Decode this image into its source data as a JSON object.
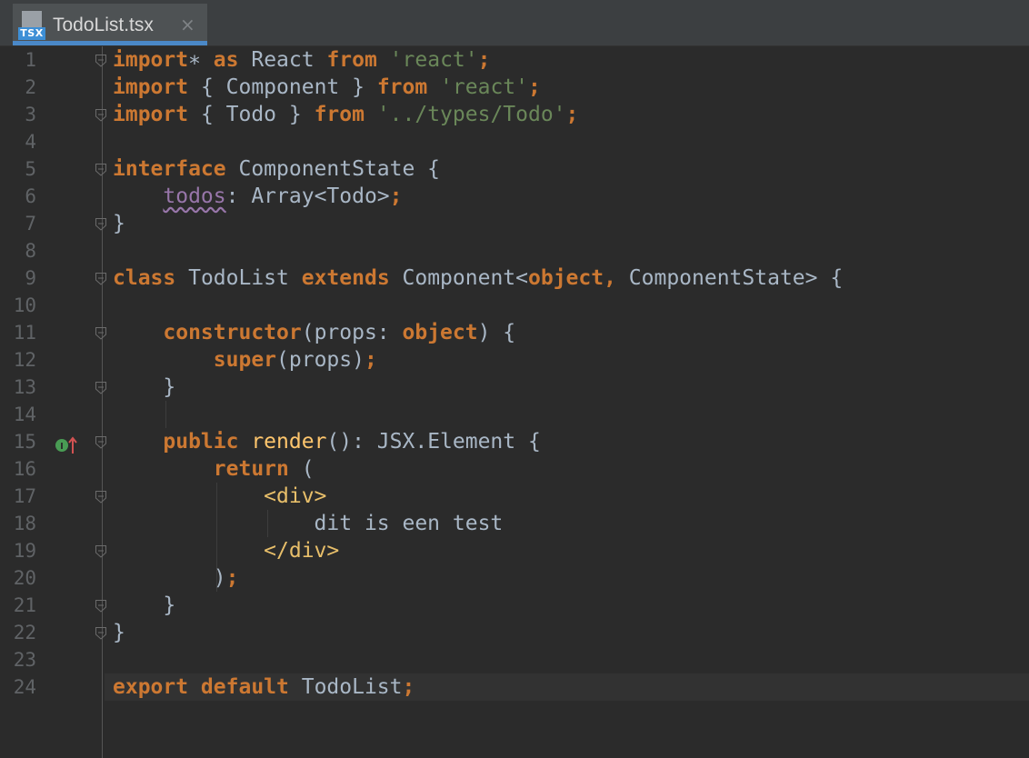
{
  "tab": {
    "file_type_badge": "TSX",
    "title": "TodoList.tsx",
    "close_glyph": "×"
  },
  "editor": {
    "line_numbers": [
      "1",
      "2",
      "3",
      "4",
      "5",
      "6",
      "7",
      "8",
      "9",
      "10",
      "11",
      "12",
      "13",
      "14",
      "15",
      "16",
      "17",
      "18",
      "19",
      "20",
      "21",
      "22",
      "23",
      "24"
    ],
    "gutter_icons": {
      "line15": "implements-method-icon"
    },
    "lines": [
      [
        [
          "kw",
          "import"
        ],
        [
          "",
          "∗"
        ],
        [
          "kw",
          " as"
        ],
        [
          "",
          " React "
        ],
        [
          "kw",
          "from"
        ],
        [
          "str",
          " 'react'"
        ],
        [
          "kw",
          ";"
        ]
      ],
      [
        [
          "kw",
          "import"
        ],
        [
          "",
          " { Component } "
        ],
        [
          "kw",
          "from"
        ],
        [
          "str",
          " 'react'"
        ],
        [
          "kw",
          ";"
        ]
      ],
      [
        [
          "kw",
          "import"
        ],
        [
          "",
          " { Todo } "
        ],
        [
          "kw",
          "from"
        ],
        [
          "str",
          " '../types/Todo'"
        ],
        [
          "kw",
          ";"
        ]
      ],
      [],
      [
        [
          "kw",
          "interface"
        ],
        [
          "",
          " ComponentState {"
        ]
      ],
      [
        [
          "",
          "    "
        ],
        [
          "field",
          "todos"
        ],
        [
          "",
          ": Array<Todo>"
        ],
        [
          "kw",
          ";"
        ]
      ],
      [
        [
          "",
          "}"
        ]
      ],
      [],
      [
        [
          "kw",
          "class"
        ],
        [
          "",
          " TodoList "
        ],
        [
          "kw",
          "extends"
        ],
        [
          "",
          " Component<"
        ],
        [
          "kw",
          "object,"
        ],
        [
          "",
          " ComponentState> {"
        ]
      ],
      [],
      [
        [
          "",
          "    "
        ],
        [
          "kw",
          "constructor"
        ],
        [
          "",
          "(props: "
        ],
        [
          "kw",
          "object"
        ],
        [
          "",
          ") {"
        ]
      ],
      [
        [
          "",
          "        "
        ],
        [
          "kw",
          "super"
        ],
        [
          "",
          "(props)"
        ],
        [
          "kw",
          ";"
        ]
      ],
      [
        [
          "",
          "    }"
        ]
      ],
      [],
      [
        [
          "",
          "    "
        ],
        [
          "kw",
          "public"
        ],
        [
          "fn",
          " render"
        ],
        [
          "",
          "(): JSX.Element {"
        ]
      ],
      [
        [
          "",
          "        "
        ],
        [
          "kw",
          "return"
        ],
        [
          "",
          " ("
        ]
      ],
      [
        [
          "",
          "            "
        ],
        [
          "tag",
          "<div>"
        ]
      ],
      [
        [
          "",
          "                dit is een test"
        ]
      ],
      [
        [
          "",
          "            "
        ],
        [
          "tag",
          "</div>"
        ]
      ],
      [
        [
          "",
          "        )"
        ],
        [
          "kw",
          ";"
        ]
      ],
      [
        [
          "",
          "    }"
        ]
      ],
      [
        [
          "",
          "}"
        ]
      ],
      [],
      [
        [
          "kw",
          "export default"
        ],
        [
          "",
          " TodoList"
        ],
        [
          "kw",
          ";"
        ]
      ]
    ],
    "folds": [
      1,
      3,
      5,
      7,
      9,
      11,
      13,
      15,
      17,
      19,
      21,
      22
    ]
  },
  "colors": {
    "background": "#2b2b2b",
    "keyword": "#cc7832",
    "string": "#6a8759",
    "function": "#ffc66d",
    "field": "#9876aa",
    "tag": "#e8bf6a",
    "text": "#a9b7c6",
    "line_number": "#606366"
  }
}
